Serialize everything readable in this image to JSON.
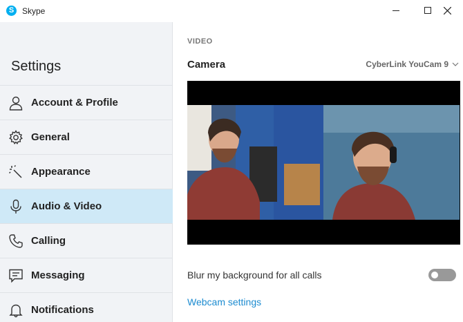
{
  "window": {
    "title": "Skype",
    "app_icon_letter": "S",
    "accent_color": "#00aff0"
  },
  "sidebar": {
    "heading": "Settings",
    "items": [
      {
        "label": "Account & Profile",
        "icon": "person-icon",
        "active": false
      },
      {
        "label": "General",
        "icon": "gear-icon",
        "active": false
      },
      {
        "label": "Appearance",
        "icon": "magic-wand-icon",
        "active": false
      },
      {
        "label": "Audio & Video",
        "icon": "microphone-icon",
        "active": true
      },
      {
        "label": "Calling",
        "icon": "phone-icon",
        "active": false
      },
      {
        "label": "Messaging",
        "icon": "chat-icon",
        "active": false
      },
      {
        "label": "Notifications",
        "icon": "bell-icon",
        "active": false
      }
    ]
  },
  "main": {
    "section_label": "VIDEO",
    "camera_label": "Camera",
    "camera_selected": "CyberLink YouCam 9",
    "blur_label": "Blur my background for all calls",
    "blur_enabled": false,
    "webcam_settings_link": "Webcam settings"
  }
}
